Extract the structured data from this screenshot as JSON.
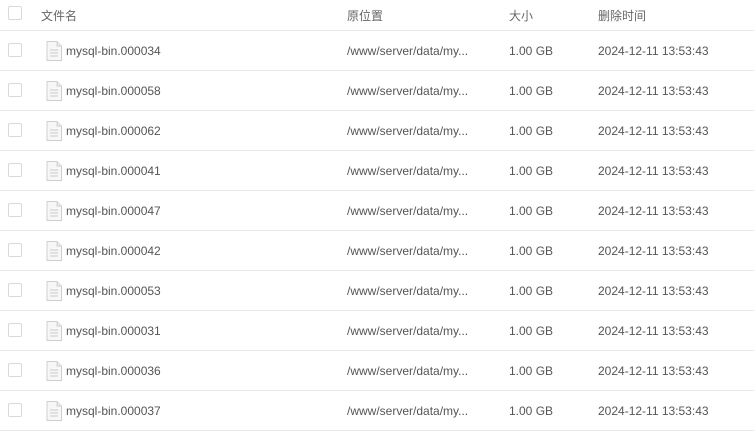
{
  "header": {
    "name": "文件名",
    "path": "原位置",
    "size": "大小",
    "time": "删除时间"
  },
  "rows": [
    {
      "name": "mysql-bin.000034",
      "path": "/www/server/data/my...",
      "size": "1.00 GB",
      "time": "2024-12-11 13:53:43"
    },
    {
      "name": "mysql-bin.000058",
      "path": "/www/server/data/my...",
      "size": "1.00 GB",
      "time": "2024-12-11 13:53:43"
    },
    {
      "name": "mysql-bin.000062",
      "path": "/www/server/data/my...",
      "size": "1.00 GB",
      "time": "2024-12-11 13:53:43"
    },
    {
      "name": "mysql-bin.000041",
      "path": "/www/server/data/my...",
      "size": "1.00 GB",
      "time": "2024-12-11 13:53:43"
    },
    {
      "name": "mysql-bin.000047",
      "path": "/www/server/data/my...",
      "size": "1.00 GB",
      "time": "2024-12-11 13:53:43"
    },
    {
      "name": "mysql-bin.000042",
      "path": "/www/server/data/my...",
      "size": "1.00 GB",
      "time": "2024-12-11 13:53:43"
    },
    {
      "name": "mysql-bin.000053",
      "path": "/www/server/data/my...",
      "size": "1.00 GB",
      "time": "2024-12-11 13:53:43"
    },
    {
      "name": "mysql-bin.000031",
      "path": "/www/server/data/my...",
      "size": "1.00 GB",
      "time": "2024-12-11 13:53:43"
    },
    {
      "name": "mysql-bin.000036",
      "path": "/www/server/data/my...",
      "size": "1.00 GB",
      "time": "2024-12-11 13:53:43"
    },
    {
      "name": "mysql-bin.000037",
      "path": "/www/server/data/my...",
      "size": "1.00 GB",
      "time": "2024-12-11 13:53:43"
    }
  ],
  "icons": {
    "file": "file-icon",
    "checkbox": "checkbox-icon"
  },
  "colors": {
    "border": "#e8e8e8",
    "text": "#555555",
    "checkbox_border": "#d9d9d9"
  }
}
